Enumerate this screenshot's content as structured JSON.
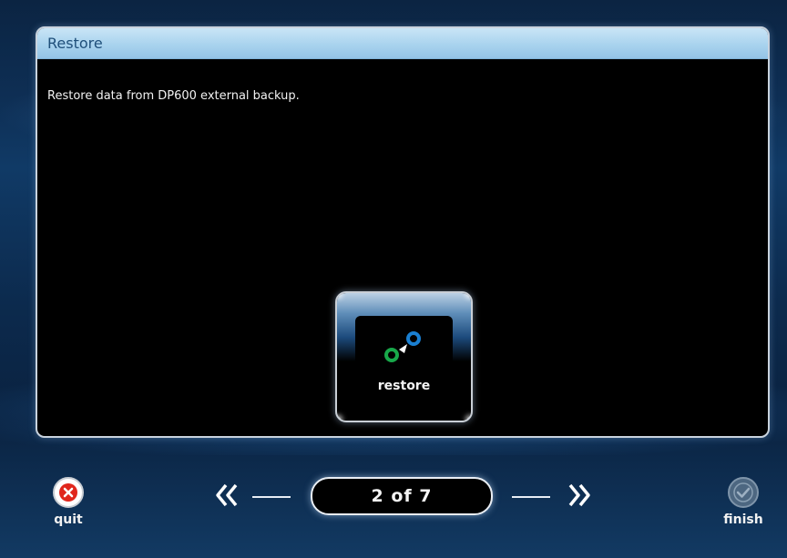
{
  "panel": {
    "title": "Restore",
    "description": "Restore data from DP600 external backup."
  },
  "tile": {
    "label": "restore",
    "icon": "restore-icon"
  },
  "footer": {
    "quit_label": "quit",
    "finish_label": "finish",
    "page_indicator": "2 of 7"
  },
  "colors": {
    "header_blue": "#a9d3ee",
    "title_text": "#1f4f7a",
    "quit_red": "#e0261c",
    "icon_green": "#18a84a",
    "icon_blue": "#1a7fd1",
    "finish_disabled": "#5b7590"
  },
  "icons": {
    "prev": "double-chevron-left-icon",
    "next": "double-chevron-right-icon",
    "quit": "close-circle-icon",
    "finish": "check-circle-icon"
  }
}
